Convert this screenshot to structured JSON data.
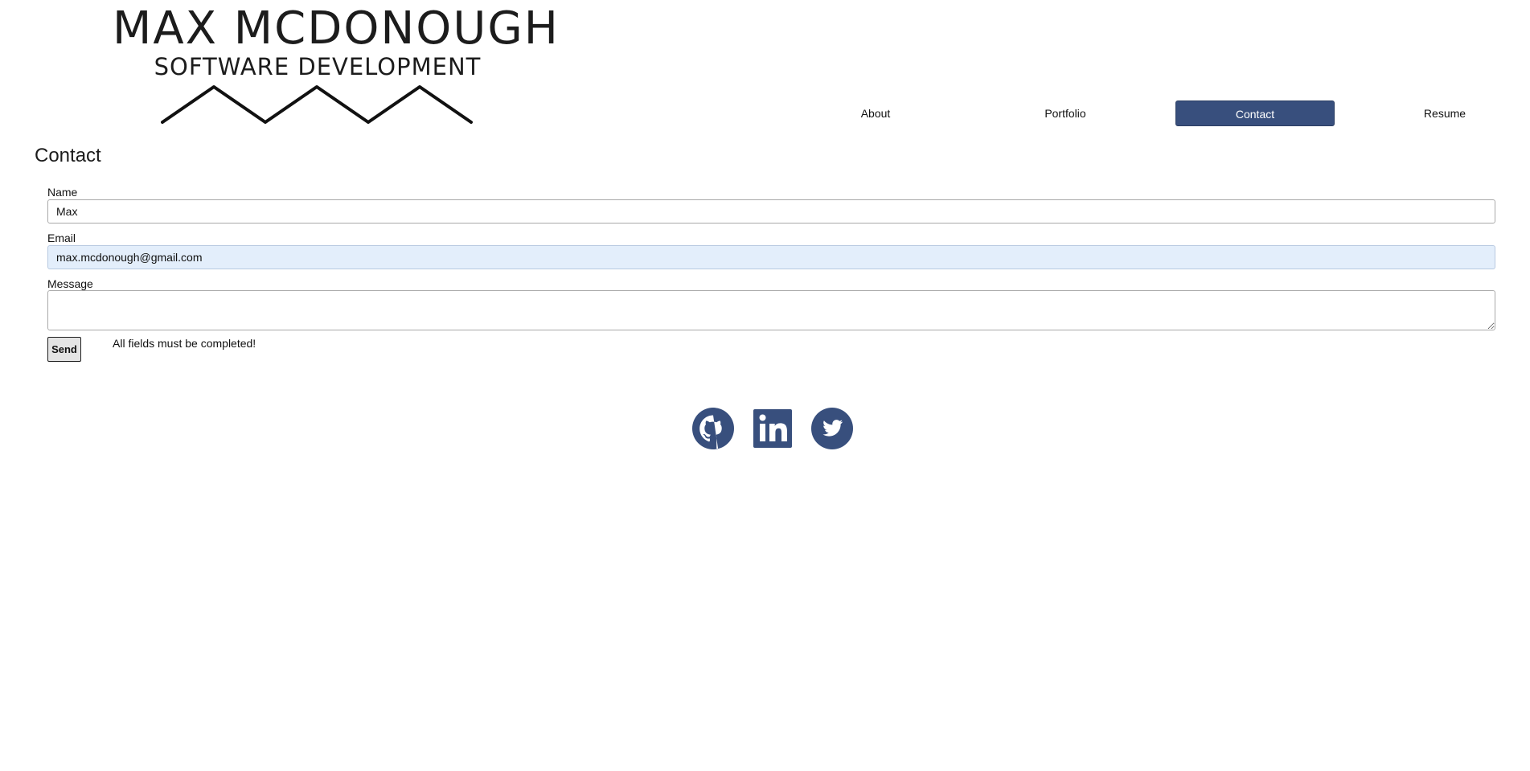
{
  "header": {
    "title": "MAX MCDONOUGH",
    "subtitle": "SOFTWARE DEVELOPMENT"
  },
  "nav": {
    "items": [
      {
        "label": "About",
        "active": false
      },
      {
        "label": "Portfolio",
        "active": false
      },
      {
        "label": "Contact",
        "active": true
      },
      {
        "label": "Resume",
        "active": false
      }
    ]
  },
  "contact": {
    "heading": "Contact",
    "name_label": "Name",
    "name_value": "Max",
    "email_label": "Email",
    "email_value": "max.mcdonough@gmail.com",
    "message_label": "Message",
    "message_value": "",
    "send_label": "Send",
    "validation_message": "All fields must be completed!"
  },
  "social": {
    "icons": [
      "github-icon",
      "linkedin-icon",
      "twitter-icon"
    ]
  },
  "colors": {
    "accent": "#384f7d",
    "autofill_bg": "#e3eefb",
    "text": "#1c1c1c"
  }
}
